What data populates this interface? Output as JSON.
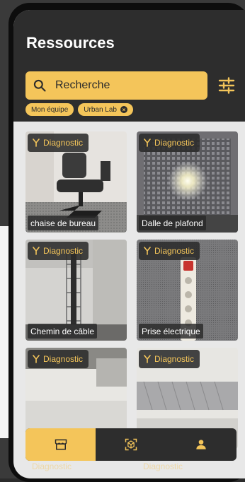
{
  "header": {
    "title": "Ressources"
  },
  "search": {
    "label": "Recherche"
  },
  "filters": {
    "chips": [
      {
        "label": "Mon équipe",
        "removable": false
      },
      {
        "label": "Urban Lab",
        "removable": true
      }
    ]
  },
  "colors": {
    "accent": "#f4c55a",
    "dark": "#2d2d2d"
  },
  "cards": [
    {
      "badge": "Diagnostic",
      "label": "chaise de bureau",
      "icon": "diagnostic-icon"
    },
    {
      "badge": "Diagnostic",
      "label": "Dalle de plafond",
      "icon": "diagnostic-icon"
    },
    {
      "badge": "Diagnostic",
      "label": "Chemin de câble",
      "icon": "diagnostic-icon"
    },
    {
      "badge": "Diagnostic",
      "label": "Prise électrique",
      "icon": "diagnostic-icon"
    },
    {
      "badge": "Diagnostic",
      "label": "",
      "icon": "diagnostic-icon"
    },
    {
      "badge": "Diagnostic",
      "label": "",
      "icon": "diagnostic-icon"
    }
  ],
  "nav": {
    "items": [
      {
        "icon": "store-icon",
        "active": true
      },
      {
        "icon": "scan-icon",
        "active": false
      },
      {
        "icon": "user-icon",
        "active": false
      }
    ]
  },
  "peek": {
    "left": "Diagnostic",
    "right": "Diagnostic"
  }
}
